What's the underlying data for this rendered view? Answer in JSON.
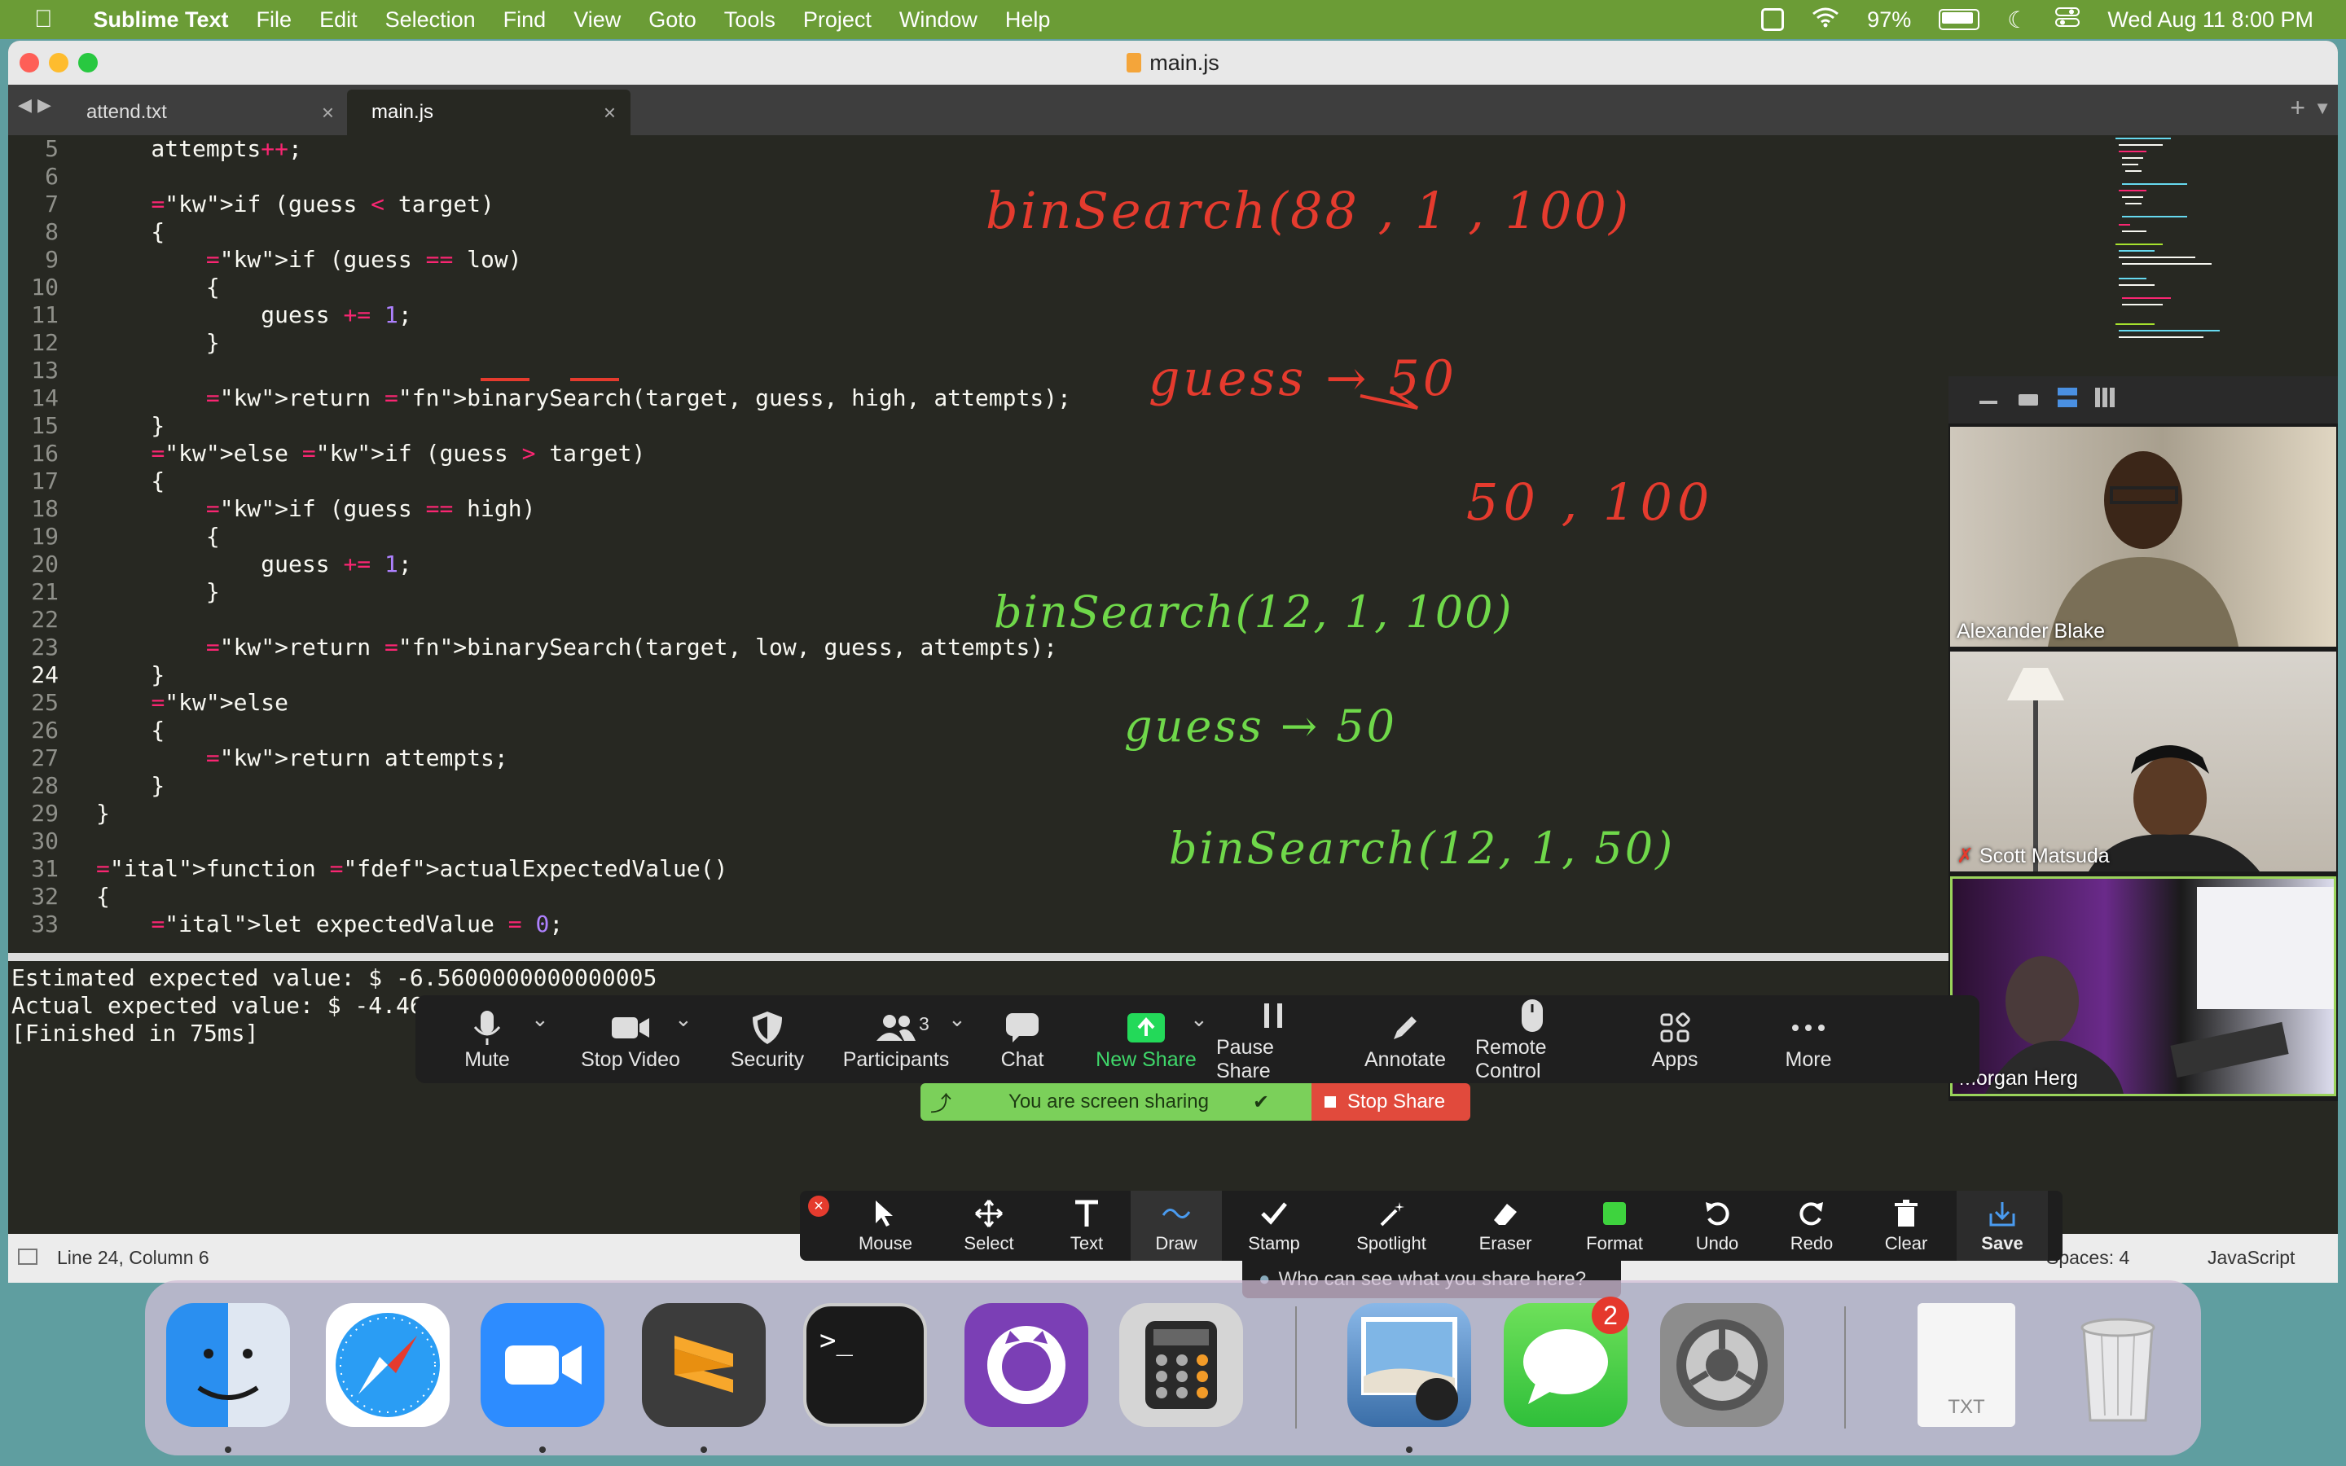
{
  "menubar": {
    "app": "Sublime Text",
    "items": [
      "File",
      "Edit",
      "Selection",
      "Find",
      "View",
      "Goto",
      "Tools",
      "Project",
      "Window",
      "Help"
    ],
    "battery": "97%",
    "datetime": "Wed Aug 11  8:00 PM"
  },
  "window": {
    "title": "main.js",
    "tabs": [
      {
        "label": "attend.txt"
      },
      {
        "label": "main.js"
      }
    ]
  },
  "editor": {
    "lines": [
      {
        "n": "5",
        "text": "    attempts++;"
      },
      {
        "n": "6",
        "text": ""
      },
      {
        "n": "7",
        "text": "    if (guess < target)"
      },
      {
        "n": "8",
        "text": "    {"
      },
      {
        "n": "9",
        "text": "        if (guess == low)"
      },
      {
        "n": "10",
        "text": "        {"
      },
      {
        "n": "11",
        "text": "            guess += 1;"
      },
      {
        "n": "12",
        "text": "        }"
      },
      {
        "n": "13",
        "text": ""
      },
      {
        "n": "14",
        "text": "        return binarySearch(target, guess, high, attempts);"
      },
      {
        "n": "15",
        "text": "    }"
      },
      {
        "n": "16",
        "text": "    else if (guess > target)"
      },
      {
        "n": "17",
        "text": "    {"
      },
      {
        "n": "18",
        "text": "        if (guess == high)"
      },
      {
        "n": "19",
        "text": "        {"
      },
      {
        "n": "20",
        "text": "            guess += 1;"
      },
      {
        "n": "21",
        "text": "        }"
      },
      {
        "n": "22",
        "text": ""
      },
      {
        "n": "23",
        "text": "        return binarySearch(target, low, guess, attempts);"
      },
      {
        "n": "24",
        "text": "    }"
      },
      {
        "n": "25",
        "text": "    else"
      },
      {
        "n": "26",
        "text": "    {"
      },
      {
        "n": "27",
        "text": "        return attempts;"
      },
      {
        "n": "28",
        "text": "    }"
      },
      {
        "n": "29",
        "text": "}"
      },
      {
        "n": "30",
        "text": ""
      },
      {
        "n": "31",
        "text": "function actualExpectedValue()"
      },
      {
        "n": "32",
        "text": "{"
      },
      {
        "n": "33",
        "text": "    let expectedValue = 0;"
      }
    ],
    "current_line": "24"
  },
  "annotations": {
    "red": [
      "binSearch(88 , 1 , 100)",
      "guess → 50",
      "50 , 100"
    ],
    "green": [
      "binSearch(12, 1, 100)",
      "guess → 50",
      "binSearch(12, 1, 50)"
    ]
  },
  "output": {
    "lines": [
      "Estimated expected value: $ -6.5600000000000005",
      "Actual expected value: $ -4.46",
      "[Finished in 75ms]"
    ]
  },
  "statusbar": {
    "position": "Line 24, Column 6",
    "spaces": "Spaces: 4",
    "syntax": "JavaScript"
  },
  "zoom": {
    "controls": [
      {
        "label": "Mute",
        "icon": "microphone-icon"
      },
      {
        "label": "Stop Video",
        "icon": "video-camera-icon"
      },
      {
        "label": "Security",
        "icon": "shield-icon"
      },
      {
        "label": "Participants",
        "icon": "participants-icon",
        "count": "3"
      },
      {
        "label": "Chat",
        "icon": "chat-icon"
      },
      {
        "label": "New Share",
        "icon": "share-arrow-icon"
      },
      {
        "label": "Pause Share",
        "icon": "pause-icon"
      },
      {
        "label": "Annotate",
        "icon": "pencil-icon"
      },
      {
        "label": "Remote Control",
        "icon": "mouse-icon"
      },
      {
        "label": "Apps",
        "icon": "apps-icon"
      },
      {
        "label": "More",
        "icon": "more-dots-icon"
      }
    ],
    "sharing_status": "You are screen sharing",
    "stop_share": "Stop Share",
    "annotate_tools": [
      {
        "label": "Mouse",
        "icon": "cursor-icon"
      },
      {
        "label": "Select",
        "icon": "move-icon"
      },
      {
        "label": "Text",
        "icon": "text-icon"
      },
      {
        "label": "Draw",
        "icon": "draw-wave-icon"
      },
      {
        "label": "Stamp",
        "icon": "checkmark-icon"
      },
      {
        "label": "Spotlight",
        "icon": "wand-icon"
      },
      {
        "label": "Eraser",
        "icon": "eraser-icon"
      },
      {
        "label": "Format",
        "icon": "color-swatch-icon"
      },
      {
        "label": "Undo",
        "icon": "undo-icon"
      },
      {
        "label": "Redo",
        "icon": "redo-icon"
      },
      {
        "label": "Clear",
        "icon": "trash-icon"
      },
      {
        "label": "Save",
        "icon": "save-icon"
      }
    ],
    "who_can_see": "Who can see what you share here?",
    "participants": [
      {
        "name": "Alexander Blake"
      },
      {
        "name": "Scott Matsuda"
      },
      {
        "name": "Morgan Herg"
      }
    ]
  },
  "dock": {
    "apps": [
      "Finder",
      "Safari",
      "Zoom",
      "Sublime Text",
      "Terminal",
      "GitHub Desktop",
      "Calculator",
      "Preview",
      "Messages",
      "System Preferences",
      "TXT",
      "Trash"
    ],
    "messages_badge": "2",
    "txt_label": "TXT"
  }
}
